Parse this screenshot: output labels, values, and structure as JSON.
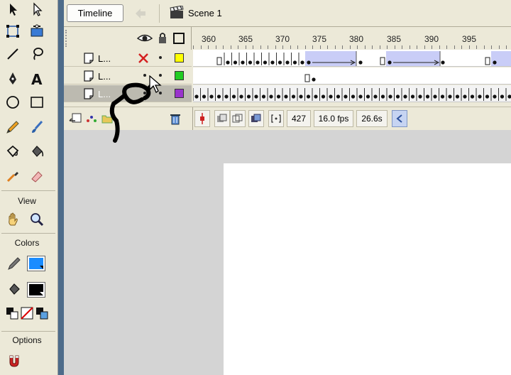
{
  "header": {
    "timeline_label": "Timeline",
    "scene_label": "Scene 1"
  },
  "tools": {
    "view_label": "View",
    "colors_label": "Colors",
    "options_label": "Options",
    "stroke_color": "#000000",
    "fill_color": "#1a8cff",
    "fill2_color": "#000000"
  },
  "ruler": {
    "labels": [
      "360",
      "365",
      "370",
      "375",
      "380",
      "385",
      "390",
      "395"
    ]
  },
  "layers": [
    {
      "name": "L...",
      "color": "#ffff00"
    },
    {
      "name": "L...",
      "color": "#22cc22"
    },
    {
      "name": "L...",
      "color": "#9933cc"
    }
  ],
  "status": {
    "current_frame": "427",
    "fps": "16.0 fps",
    "elapsed": "26.6s"
  },
  "colors": {
    "frame_selected": "#c9cdf7",
    "panel_bg": "#ece9d8"
  }
}
